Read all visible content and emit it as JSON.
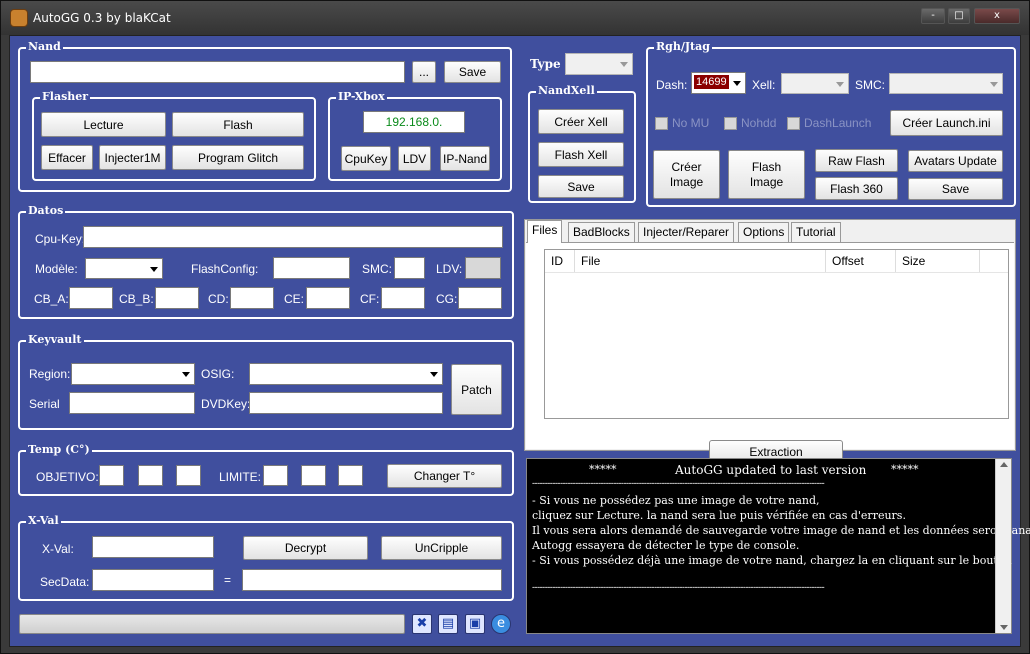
{
  "window": {
    "title": "AutoGG 0.3 by blaKCat",
    "minimize": "-",
    "maximize": "□",
    "close": "x"
  },
  "nand": {
    "label": "Nand",
    "path_value": "",
    "browse": "...",
    "save": "Save"
  },
  "flasher": {
    "label": "Flasher",
    "lecture": "Lecture",
    "flash": "Flash",
    "effacer": "Effacer",
    "injecter1m": "Injecter1M",
    "program_glitch": "Program Glitch"
  },
  "ipxbox": {
    "label": "IP-Xbox",
    "ip": "192.168.0.",
    "cpukey": "CpuKey",
    "ldv": "LDV",
    "ipnand": "IP-Nand"
  },
  "type": {
    "label": "Type"
  },
  "nandxell": {
    "label": "NandXell",
    "creer_xell": "Créer Xell",
    "flash_xell": "Flash Xell",
    "save": "Save"
  },
  "rgh": {
    "label": "Rgh/Jtag",
    "dash_label": "Dash:",
    "dash_value": "14699",
    "xell_label": "Xell:",
    "smc_label": "SMC:",
    "nomu": "No MU",
    "nohdd": "Nohdd",
    "dashlaunch": "DashLaunch",
    "creer_launch": "Créer Launch.ini",
    "creer_image": "Créer Image",
    "flash_image": "Flash Image",
    "raw_flash": "Raw Flash",
    "avatars_update": "Avatars Update",
    "flash_360": "Flash 360",
    "save": "Save"
  },
  "datos": {
    "label": "Datos",
    "cpukey": "Cpu-Key:",
    "modele": "Modèle:",
    "flashconfig": "FlashConfig:",
    "smc": "SMC:",
    "ldv": "LDV:",
    "cba": "CB_A:",
    "cbb": "CB_B:",
    "cd": "CD:",
    "ce": "CE:",
    "cf": "CF:",
    "cg": "CG:"
  },
  "keyvault": {
    "label": "Keyvault",
    "region": "Region:",
    "osig": "OSIG:",
    "serial": "Serial",
    "dvdkey": "DVDKey:",
    "patch": "Patch"
  },
  "temp": {
    "label": "Temp (C°)",
    "objetivo": "OBJETIVO:",
    "limite": "LIMITE:",
    "changer": "Changer T°"
  },
  "xval": {
    "label": "X-Val",
    "xval": "X-Val:",
    "secdata": "SecData:",
    "equals": "=",
    "decrypt": "Decrypt",
    "uncripple": "UnCripple"
  },
  "tabs": [
    "Files",
    "BadBlocks",
    "Injecter/Reparer",
    "Options",
    "Tutorial"
  ],
  "files": {
    "columns": [
      "ID",
      "File",
      "Offset",
      "Size"
    ],
    "extraction": "Extraction"
  },
  "log": {
    "line1_left": "*****",
    "line1_mid": "AutoGG updated to last version",
    "line1_right": "*****",
    "sep": "-------------------------------------------------------------------------------------------------------------------",
    "l1": "- Si vous ne possédez pas une image de votre nand,",
    "l2": "cliquez sur Lecture. la nand sera lue puis vérifiée en cas d'erreurs.",
    "l3": "Il vous sera alors demandé de sauvegarde votre image de nand et les données seront analisées et",
    "l4": "Autogg essayera de détecter le type de console.",
    "l5": "- Si vous possédez déjà une image de votre nand, chargez la en cliquant sur le bouton"
  },
  "colors": {
    "panel": "#404f9e",
    "ip_text": "#0a8a1a",
    "dash_sel": "#8b0000"
  }
}
